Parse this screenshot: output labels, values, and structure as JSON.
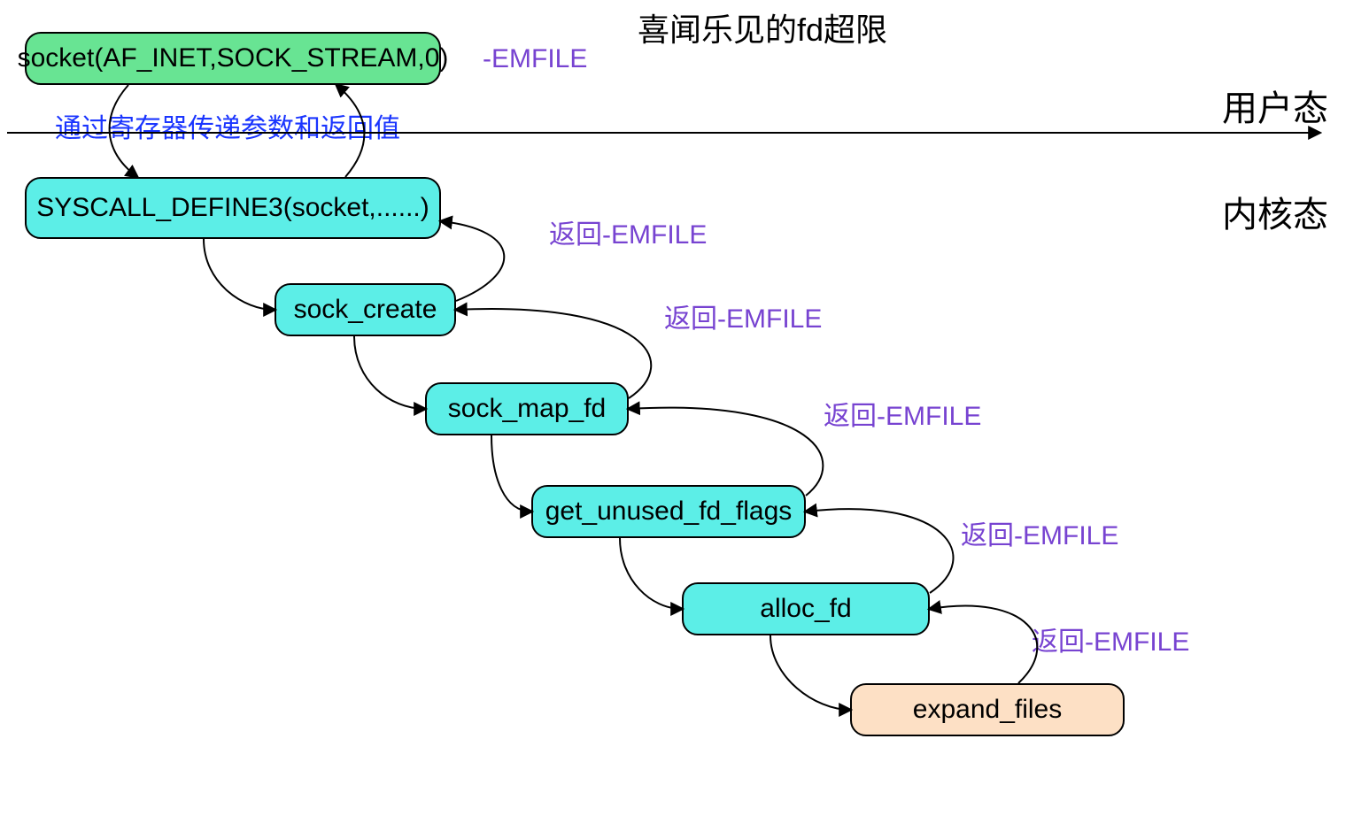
{
  "title": "喜闻乐见的fd超限",
  "zones": {
    "user": "用户态",
    "kernel": "内核态"
  },
  "nodes": {
    "socket_call": "socket(AF_INET,SOCK_STREAM,0)",
    "syscall_def": "SYSCALL_DEFINE3(socket,......)",
    "sock_create": "sock_create",
    "sock_map_fd": "sock_map_fd",
    "get_unused": "get_unused_fd_flags",
    "alloc_fd": "alloc_fd",
    "expand_files": "expand_files"
  },
  "annotations": {
    "reg_note": "通过寄存器传递参数和返回值",
    "emfile": "-EMFILE",
    "ret_emf_1": "返回-EMFILE",
    "ret_emf_2": "返回-EMFILE",
    "ret_emf_3": "返回-EMFILE",
    "ret_emf_4": "返回-EMFILE",
    "ret_emf_5": "返回-EMFILE"
  },
  "colors": {
    "green": "#68e493",
    "cyan": "#5ceee7",
    "peach": "#fde0c5",
    "blue": "#1a35ff",
    "purple": "#7743d1"
  }
}
